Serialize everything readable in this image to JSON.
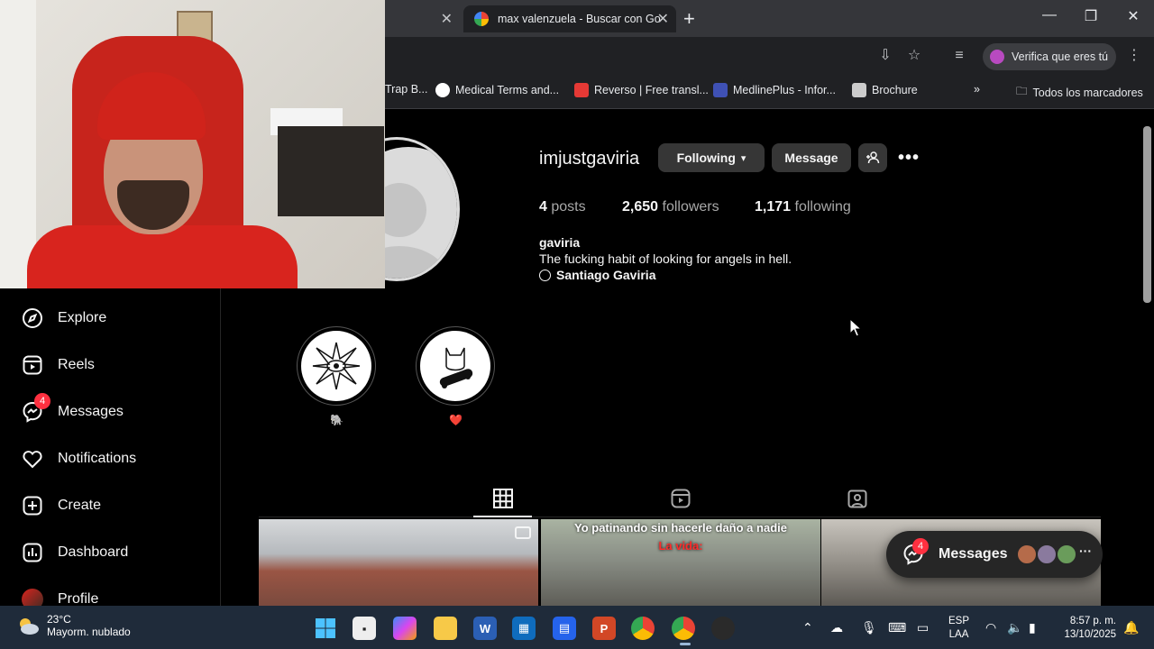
{
  "browser": {
    "tabs": [
      {
        "label": ""
      },
      {
        "label": "max valenzuela - Buscar con Go"
      }
    ],
    "verify_label": "Verifica que eres tú",
    "bookmarks": [
      {
        "label": "Trap B...",
        "color": "#888888"
      },
      {
        "label": "Medical Terms and...",
        "color": "#ffffff"
      },
      {
        "label": "Reverso | Free transl...",
        "color": "#e53935"
      },
      {
        "label": "MedlinePlus - Infor...",
        "color": "#3f51b5"
      },
      {
        "label": "Brochure",
        "color": "#cccccc"
      }
    ],
    "all_bookmarks": "Todos los marcadores"
  },
  "sidebar": {
    "items": [
      {
        "label": "Explore",
        "icon": "compass-icon"
      },
      {
        "label": "Reels",
        "icon": "reels-icon"
      },
      {
        "label": "Messages",
        "icon": "messenger-icon",
        "badge": "4"
      },
      {
        "label": "Notifications",
        "icon": "heart-icon"
      },
      {
        "label": "Create",
        "icon": "plus-square-icon"
      },
      {
        "label": "Dashboard",
        "icon": "chart-icon"
      },
      {
        "label": "Profile",
        "icon": "avatar"
      }
    ]
  },
  "profile": {
    "username": "imjustgaviria",
    "following_button": "Following",
    "message_button": "Message",
    "posts_num": "4",
    "posts_label": "posts",
    "followers_num": "2,650",
    "followers_label": "followers",
    "following_num": "1,171",
    "following_label": "following",
    "full_name": "gaviria",
    "bio": "The fucking habit of looking for angels in hell.",
    "link": "Santiago Gaviria"
  },
  "highlights": [
    {
      "label": "🐘"
    },
    {
      "label": "❤️"
    }
  ],
  "posts": [
    {
      "caption_line1": "",
      "caption_line2": ""
    },
    {
      "caption_line1": "Yo patinando sin hacerle daño a nadie",
      "caption_line2": "La vida:"
    },
    {
      "caption_line1": "",
      "caption_line2": ""
    }
  ],
  "messages_pill": {
    "label": "Messages",
    "badge": "4"
  },
  "taskbar": {
    "temp": "23°C",
    "weather": "Mayorm. nublado",
    "lang_line1": "ESP",
    "lang_line2": "LAA",
    "time": "8:57 p. m.",
    "date": "13/10/2025"
  },
  "colors": {
    "accent_badge": "#ff3040",
    "chrome_dark": "#202124",
    "taskbar": "#1f2b3a"
  }
}
